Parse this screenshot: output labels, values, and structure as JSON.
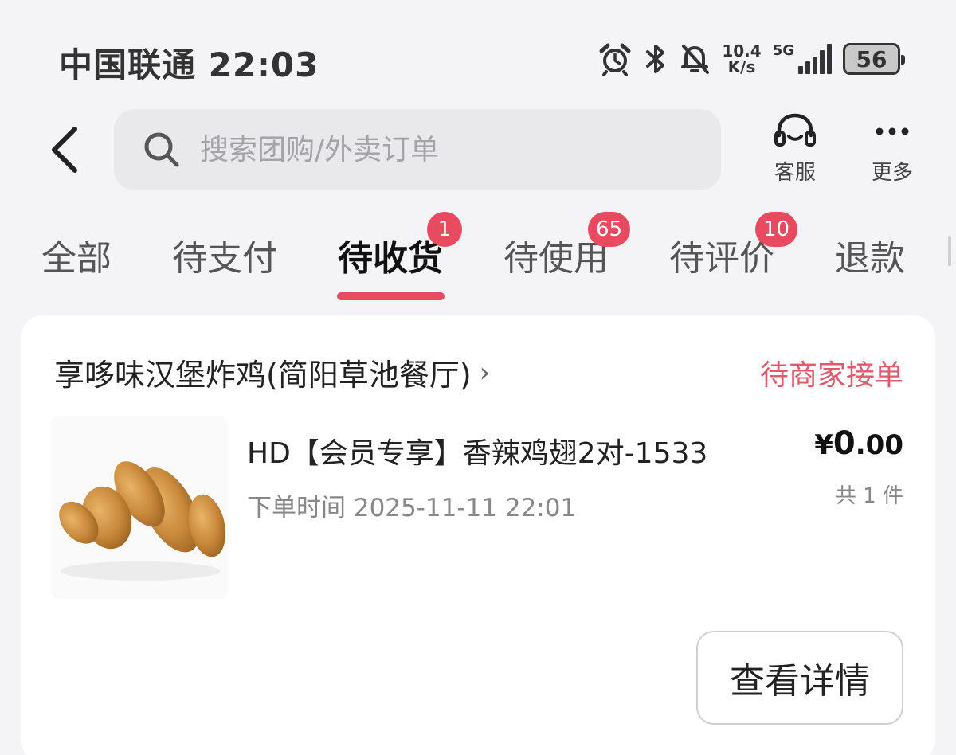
{
  "status_bar": {
    "carrier_time": "中国联通 22:03",
    "net_speed_value": "10.4",
    "net_speed_unit": "K/s",
    "network_type": "5G",
    "battery": "56",
    "icons": [
      "alarm-icon",
      "bluetooth-icon",
      "mute-icon",
      "signal-icon",
      "battery-icon"
    ]
  },
  "header": {
    "search_placeholder": "搜索团购/外卖订单",
    "service_label": "客服",
    "more_label": "更多"
  },
  "tabs": [
    {
      "label": "全部",
      "badge": "",
      "active": false
    },
    {
      "label": "待支付",
      "badge": "",
      "active": false
    },
    {
      "label": "待收货",
      "badge": "1",
      "active": true
    },
    {
      "label": "待使用",
      "badge": "65",
      "active": false
    },
    {
      "label": "待评价",
      "badge": "10",
      "active": false
    },
    {
      "label": "退款",
      "badge": "",
      "active": false
    }
  ],
  "order": {
    "shop_name": "享哆味汉堡炸鸡(简阳草池餐厅)",
    "shop_chevron": "›",
    "status": "待商家接单",
    "product_title": "HD【会员专享】香辣鸡翅2对-1533",
    "order_time": "下单时间 2025-11-11 22:01",
    "price_symbol": "¥",
    "price_int": "0",
    "price_dec": ".00",
    "count": "共 1 件",
    "detail_button": "查看详情"
  },
  "colors": {
    "accent": "#e84a5f",
    "status_text": "#e05a6e",
    "background": "#f4f4f6"
  }
}
